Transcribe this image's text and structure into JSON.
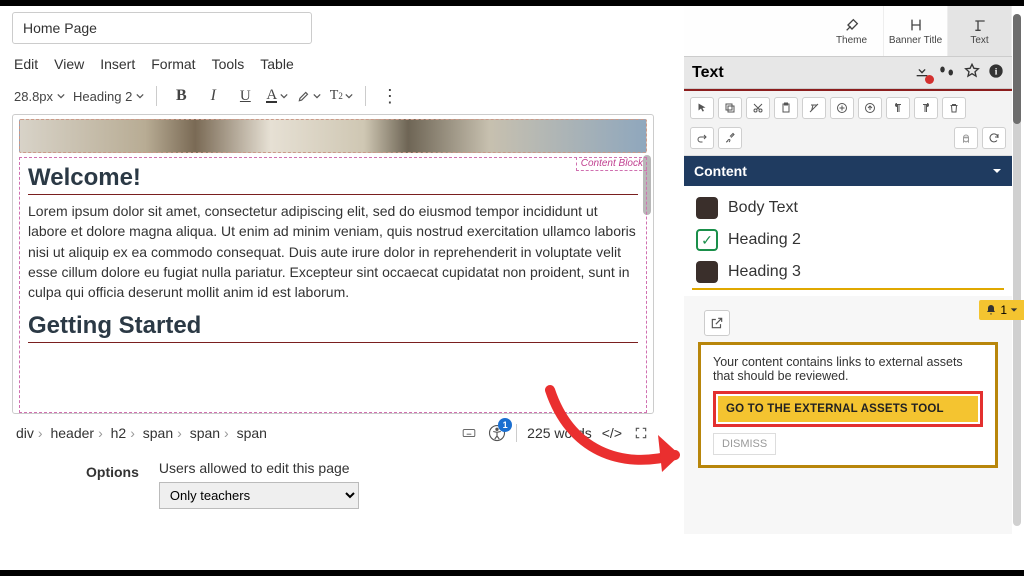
{
  "page": {
    "title": "Home Page"
  },
  "menu": {
    "edit": "Edit",
    "view": "View",
    "insert": "Insert",
    "format": "Format",
    "tools": "Tools",
    "table": "Table"
  },
  "toolbar": {
    "font_size": "28.8px",
    "block_format": "Heading 2"
  },
  "content_block_label": "Content Block",
  "body": {
    "h2a": "Welcome!",
    "para": "Lorem ipsum dolor sit amet, consectetur adipiscing elit, sed do eiusmod tempor incididunt ut labore et dolore magna aliqua. Ut enim ad minim veniam, quis nostrud exercitation ullamco laboris nisi ut aliquip ex ea commodo consequat. Duis aute irure dolor in reprehenderit in voluptate velit esse cillum dolore eu fugiat nulla pariatur. Excepteur sint occaecat cupidatat non proident, sunt in culpa qui officia deserunt mollit anim id est laborum.",
    "h2b": "Getting Started"
  },
  "path": [
    "div",
    "header",
    "h2",
    "span",
    "span",
    "span"
  ],
  "status": {
    "word_count": "225 words",
    "a11y_badge": "1",
    "code_toggle": "</>"
  },
  "options": {
    "label": "Options",
    "heading": "Users allowed to edit this page",
    "selected": "Only teachers"
  },
  "sidebar": {
    "tabs": {
      "theme": "Theme",
      "banner": "Banner Title",
      "text": "Text"
    },
    "section_title": "Text",
    "content_title": "Content",
    "items": {
      "body": "Body Text",
      "h2": "Heading 2",
      "h3": "Heading 3"
    },
    "bell_count": "1"
  },
  "warning": {
    "message": "Your content contains links to external assets that should be reviewed.",
    "go_button": "GO TO THE EXTERNAL ASSETS TOOL",
    "dismiss": "DISMISS"
  }
}
